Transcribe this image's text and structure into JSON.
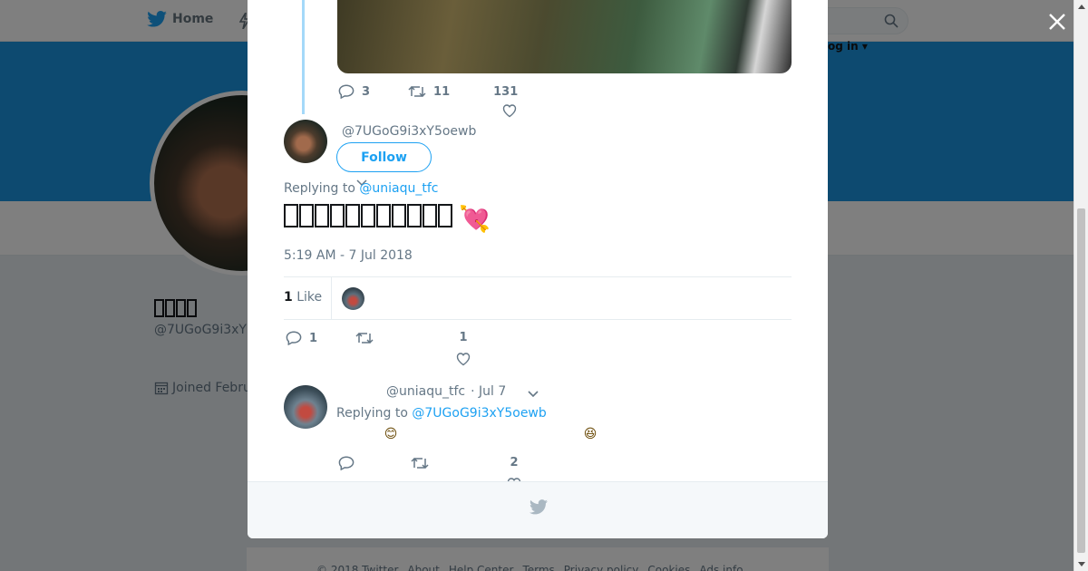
{
  "topbar": {
    "home_label": "Home",
    "login_label": "og in ▾"
  },
  "profile": {
    "name": "",
    "handle": "@7UGoG9i3xY",
    "joined": "Joined Febru"
  },
  "parent_tweet": {
    "reply_count": "3",
    "retweet_count": "11",
    "like_count": "131"
  },
  "tweet": {
    "handle": "@7UGoG9i3xY5oewb",
    "follow_label": "Follow",
    "replying_prefix": "Replying to",
    "replying_handle": "@uniaqu_tfc",
    "text_glyph_count": 11,
    "emoji": "💘",
    "timestamp": "5:19 AM - 7 Jul 2018",
    "likes_count": "1",
    "likes_label": "Like",
    "reply_count": "1",
    "retweet_count": "",
    "like_count": "1"
  },
  "reply": {
    "handle": "@uniaqu_tfc",
    "date": "· Jul 7",
    "replying_prefix": "Replying to",
    "replying_handle": "@7UGoG9i3xY5oewb",
    "emoji_1": "😊",
    "emoji_2": "😆",
    "reply_count": "",
    "retweet_count": "",
    "like_count": "2"
  },
  "footer": {
    "links": [
      "© 2018 Twitter",
      "About",
      "Help Center",
      "Terms",
      "Privacy policy",
      "Cookies",
      "Ads info"
    ]
  },
  "colors": {
    "brand_blue": "#1da1f2",
    "banner_blue": "#1b95e0",
    "muted": "#657786"
  }
}
